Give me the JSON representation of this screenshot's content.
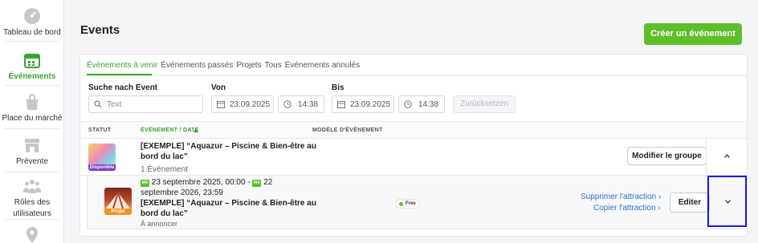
{
  "sidebar": {
    "items": [
      {
        "label": "Tableau de bord",
        "icon": "dashboard-icon",
        "active": false
      },
      {
        "label": "Événements",
        "icon": "calendar-icon",
        "active": true
      },
      {
        "label": "Place du marché",
        "icon": "shopping-bag-icon",
        "active": false
      },
      {
        "label": "Prévente",
        "icon": "store-icon",
        "active": false
      },
      {
        "label_line1": "Rôles des",
        "label_line2": "utilisateurs",
        "icon": "users-icon",
        "active": false
      },
      {
        "icon": "map-pin-icon",
        "active": false
      }
    ]
  },
  "header": {
    "title": "Events",
    "create_label": "Créer un événement"
  },
  "tabs": [
    {
      "label": "Événements à venir",
      "active": true
    },
    {
      "label": "Événements passés"
    },
    {
      "label": "Projets"
    },
    {
      "label": "Tous"
    },
    {
      "label": "Événements annulés"
    }
  ],
  "filters": {
    "search_label": "Suche nach Event",
    "search_placeholder": "Text",
    "from_label": "Von",
    "from_date": "23.09.2025",
    "from_time": "14:38",
    "to_label": "Bis",
    "to_date": "23.09.2025",
    "to_time": "14:38",
    "reset_label": "Zurücksetzen"
  },
  "table": {
    "columns": {
      "status": "STATUT",
      "event": "ÉVÉNEMENT / DATE",
      "model": "MODÈLE D'ÉVÉNEMENT"
    }
  },
  "group": {
    "badge": "Disponible",
    "title_line1": "[EXEMPLE] “Aquazur – Piscine & Bien-être au",
    "title_line2": "bord du lac”",
    "count": "1 Événement",
    "modify_label": "Modifier le groupe"
  },
  "child": {
    "badge": "Projet",
    "tag1": "MA",
    "date_part1": "23 septembre 2025, 00:00 -",
    "tag2": "MA",
    "date_part2": "22",
    "date_line2": "septembre 2026, 23:59",
    "title_line1": "[EXEMPLE] “Aquazur – Piscine & Bien-être au",
    "title_line2": "bord du lac”",
    "status": "À annoncer",
    "model_badge": "Free",
    "delete_link": "Supprimer l'attraction ›",
    "copy_link": "Copier l'attraction ›",
    "edit_label": "Editer"
  },
  "colors": {
    "accent": "#5fbf2a",
    "link": "#2e6fd6",
    "focus": "#1c1cd9"
  }
}
